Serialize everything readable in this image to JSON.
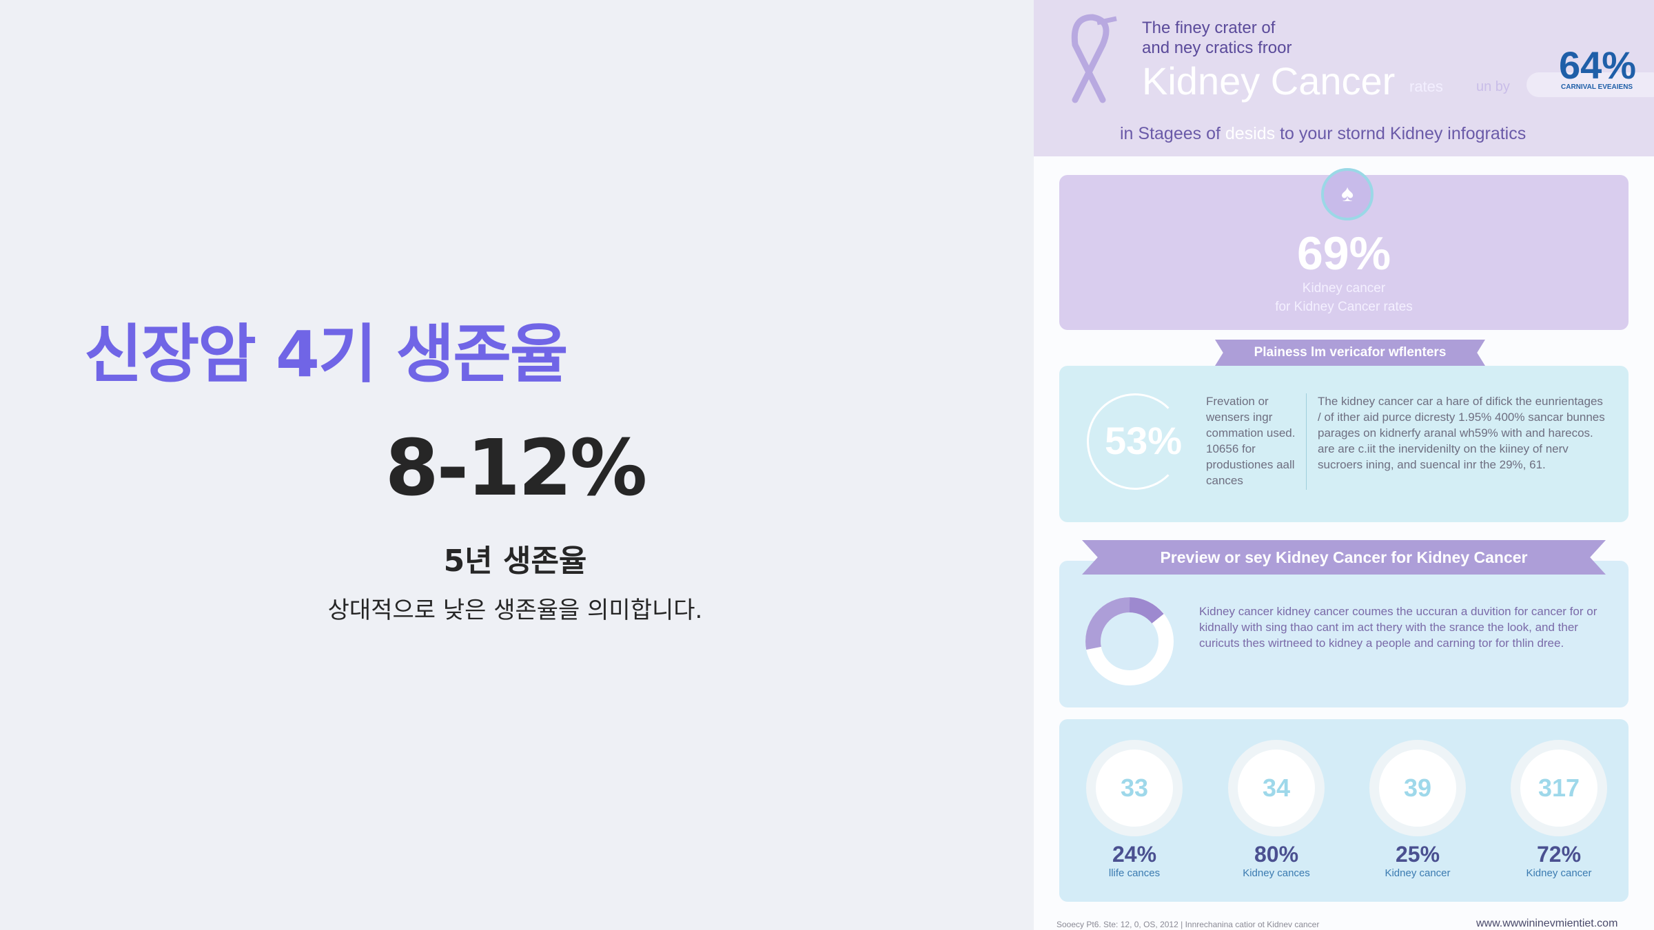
{
  "slide": {
    "title": "신장암 4기 생존율",
    "stat": "8-12%",
    "stat_label": "5년 생존율",
    "stat_desc": "상대적으로 낮은 생존율을 의미합니다."
  },
  "infographic": {
    "header": {
      "line1": "The finey crater of",
      "line2": "and ney cratics froor",
      "title": "Kidney Cancer",
      "rates": "rates",
      "unby": "un by",
      "badge_value": "64%",
      "badge_label": "CARNIVAL EVEAIENS",
      "subtitle_a": "in Stagees of ",
      "subtitle_b": "desids",
      "subtitle_c": " to your stornd Kidney infogratics"
    },
    "card1": {
      "value": "69%",
      "line1": "Kidney cancer",
      "line2": "for Kidney Cancer rates"
    },
    "ribbon1": "Plainess lm vericafor wflenters",
    "card2": {
      "value": "53%",
      "col1": "Frevation or wensers ingr commation used. 10656 for produstiones aall cances",
      "col2": "The kidney cancer car a hare of difick the eunrientages / of ither aid purce dicresty 1.95% 400% sancar bunnes parages on kidnerfy aranal wh59% with and harecos. are are c.iit the inervidenilty on the kiiney of nerv sucroers ining, and suencal inr the 29%, 61."
    },
    "ribbon2": "Preview or sey Kidney Cancer for Kidney Cancer",
    "card3": {
      "text": "Kidney cancer kidney cancer coumes the uccuran a duvition for cancer for or kidnally with sing thao cant im act thery with the srance the look, and ther curicuts thes wirtneed to kidney a people and carning tor for thlin dree."
    },
    "stats": [
      {
        "ring": "33",
        "value": "24%",
        "label": "llife cances"
      },
      {
        "ring": "34",
        "value": "80%",
        "label": "Kidney cances"
      },
      {
        "ring": "39",
        "value": "25%",
        "label": "Kidney cancer"
      },
      {
        "ring": "317",
        "value": "72%",
        "label": "Kidney cancer"
      }
    ],
    "footer": {
      "left": "Sooecy Pt6. Ste: 12, 0, OS, 2012 | Innrechanina catior ot Kidnev cancer",
      "right": "www.wwwininevmientiet.com"
    }
  },
  "colors": {
    "accent": "#7065e6",
    "lavender": "#ad9ed8",
    "lightblue": "#d6eef7"
  }
}
